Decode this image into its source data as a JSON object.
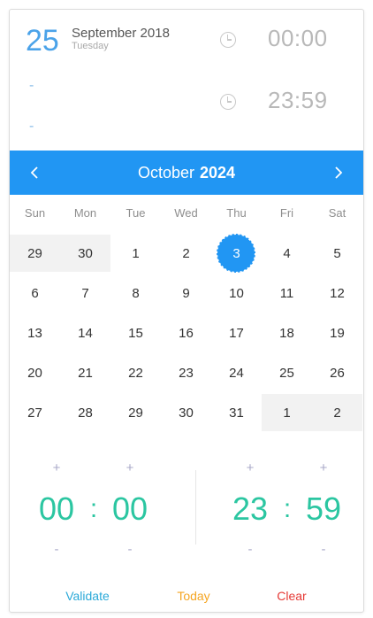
{
  "header": {
    "day": "25",
    "month_year": "September 2018",
    "weekday": "Tuesday",
    "range_dash_1": "-",
    "range_dash_2": "-",
    "start_time": "00:00",
    "end_time": "23:59"
  },
  "calendar": {
    "month": "October",
    "year": "2024",
    "weekdays": [
      "Sun",
      "Mon",
      "Tue",
      "Wed",
      "Thu",
      "Fri",
      "Sat"
    ],
    "weeks": [
      [
        "29",
        "30",
        "1",
        "2",
        "3",
        "4",
        "5"
      ],
      [
        "6",
        "7",
        "8",
        "9",
        "10",
        "11",
        "12"
      ],
      [
        "13",
        "14",
        "15",
        "16",
        "17",
        "18",
        "19"
      ],
      [
        "20",
        "21",
        "22",
        "23",
        "24",
        "25",
        "26"
      ],
      [
        "27",
        "28",
        "29",
        "30",
        "31",
        "1",
        "2"
      ]
    ],
    "selected_day": "3"
  },
  "time_picker": {
    "plus": "+",
    "minus": "-",
    "colon": ":",
    "start_hours": "00",
    "start_minutes": "00",
    "end_hours": "23",
    "end_minutes": "59"
  },
  "footer": {
    "validate": "Validate",
    "today": "Today",
    "clear": "Clear"
  },
  "colors": {
    "accent_blue": "#2196f3",
    "time_green": "#2bc6a1",
    "validate_color": "#2aa9d8",
    "today_color": "#f5a623",
    "clear_color": "#e53935"
  },
  "icons": {
    "prev": "chevron-left-icon",
    "next": "chevron-right-icon",
    "clock": "clock-icon"
  }
}
